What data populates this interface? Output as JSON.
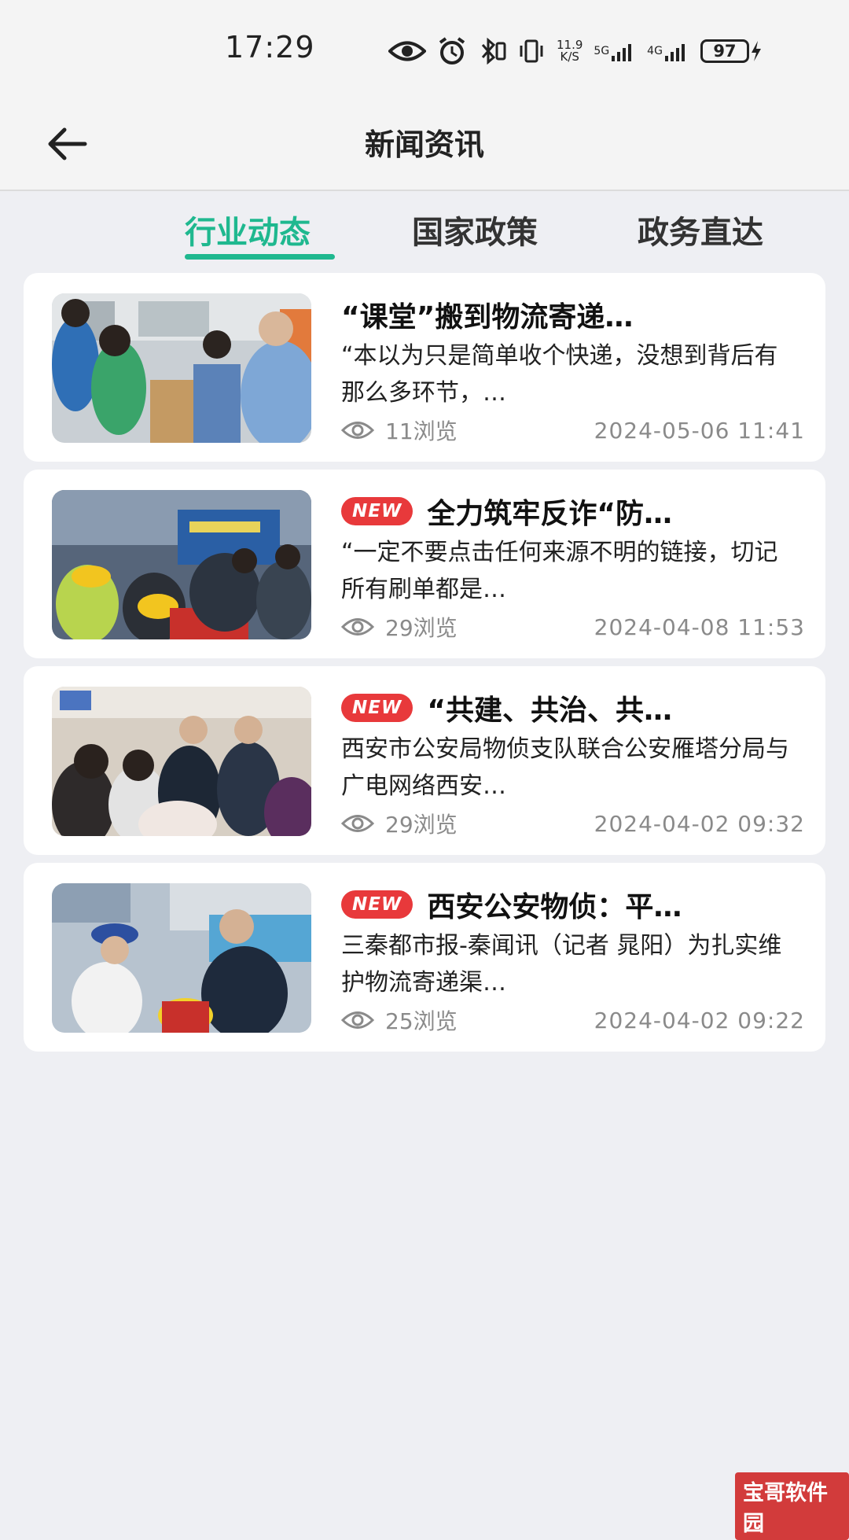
{
  "status_bar": {
    "time": "17:29",
    "net_speed_top": "11.9",
    "net_speed_bottom": "K/S",
    "signal1_label": "5G",
    "signal2_label": "4G",
    "battery": "97"
  },
  "header": {
    "title": "新闻资讯",
    "back_icon": "arrow-left-icon"
  },
  "tabs": [
    {
      "label": "行业动态",
      "active": true
    },
    {
      "label": "国家政策",
      "active": false
    },
    {
      "label": "政务直达",
      "active": false
    }
  ],
  "news": [
    {
      "badge": "",
      "title": "“课堂”搬到物流寄递…",
      "desc": "“本以为只是简单收个快递，没想到背后有那么多环节，…",
      "views": "11浏览",
      "date": "2024-05-06 11:41"
    },
    {
      "badge": "NEW",
      "title": "全力筑牢反诈“防…",
      "desc": "“一定不要点击任何来源不明的链接，切记所有刷单都是…",
      "views": "29浏览",
      "date": "2024-04-08 11:53"
    },
    {
      "badge": "NEW",
      "title": "“共建、共治、共…",
      "desc": "西安市公安局物侦支队联合公安雁塔分局与广电网络西安…",
      "views": "29浏览",
      "date": "2024-04-02 09:32"
    },
    {
      "badge": "NEW",
      "title": "西安公安物侦：平…",
      "desc": "三秦都市报-秦闻讯（记者 晁阳）为扎实维护物流寄递渠…",
      "views": "25浏览",
      "date": "2024-04-02 09:22"
    }
  ],
  "watermark": "宝哥软件园",
  "colors": {
    "accent": "#1fb88f",
    "badge": "#e8393b",
    "meta": "#8a8a8a",
    "background": "#eeeff3"
  }
}
